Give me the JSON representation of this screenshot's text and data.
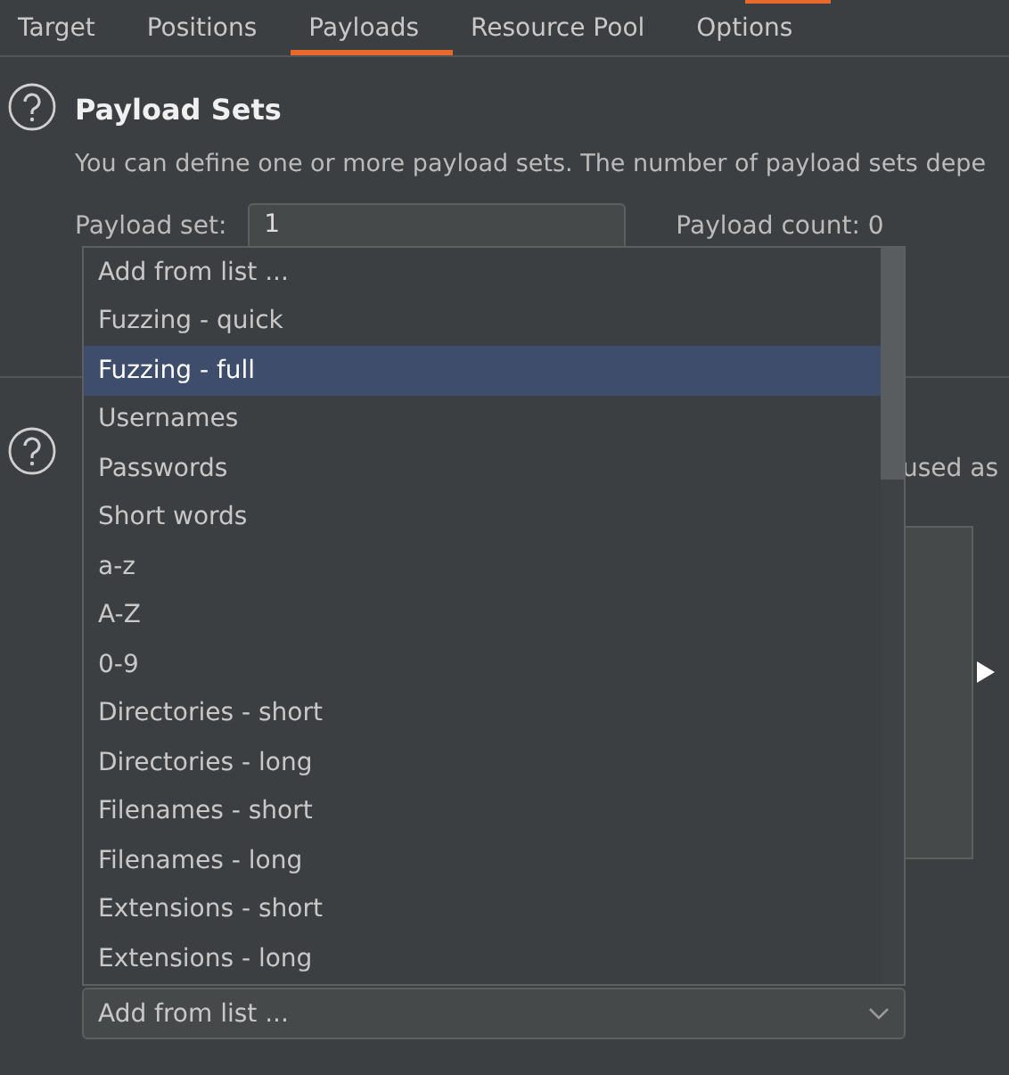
{
  "tabs": [
    {
      "label": "Target",
      "selected": false
    },
    {
      "label": "Positions",
      "selected": false
    },
    {
      "label": "Payloads",
      "selected": true
    },
    {
      "label": "Resource Pool",
      "selected": false
    },
    {
      "label": "Options",
      "selected": false
    }
  ],
  "payload_sets": {
    "title": "Payload Sets",
    "description": "You can define one or more payload sets. The number of payload sets depe",
    "payload_set_label": "Payload set:",
    "payload_set_value": "1",
    "payload_count": "Payload count: 0"
  },
  "payload_options": {
    "description_tail": "used as",
    "combo_value": "Add from list ..."
  },
  "dropdown": {
    "items": [
      {
        "label": "Add from list ...",
        "selected": false
      },
      {
        "label": "Fuzzing - quick",
        "selected": false
      },
      {
        "label": "Fuzzing - full",
        "selected": true
      },
      {
        "label": "Usernames",
        "selected": false
      },
      {
        "label": "Passwords",
        "selected": false
      },
      {
        "label": "Short words",
        "selected": false
      },
      {
        "label": "a-z",
        "selected": false
      },
      {
        "label": "A-Z",
        "selected": false
      },
      {
        "label": "0-9",
        "selected": false
      },
      {
        "label": "Directories - short",
        "selected": false
      },
      {
        "label": "Directories - long",
        "selected": false
      },
      {
        "label": "Filenames - short",
        "selected": false
      },
      {
        "label": "Filenames - long",
        "selected": false
      },
      {
        "label": "Extensions - short",
        "selected": false
      },
      {
        "label": "Extensions - long",
        "selected": false
      }
    ]
  }
}
